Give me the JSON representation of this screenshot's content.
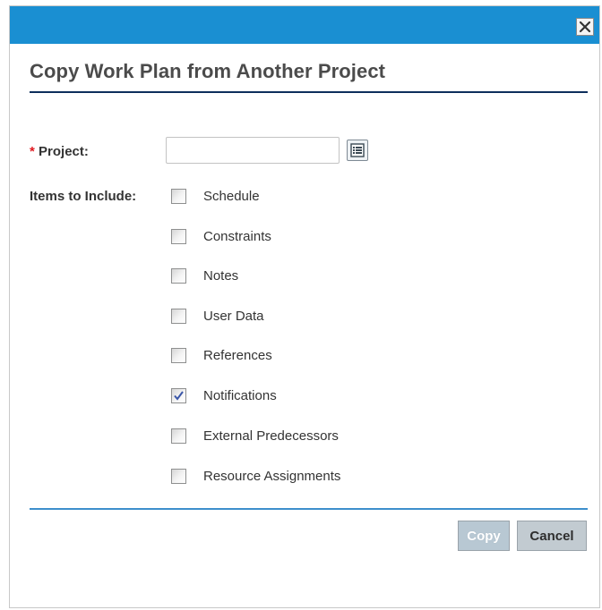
{
  "dialog": {
    "title": "Copy Work Plan from Another Project",
    "close_icon": "close-icon"
  },
  "form": {
    "required_marker": "*",
    "project_label": "Project:",
    "project_value": "",
    "project_placeholder": "",
    "lookup_icon": "list-lookup-icon",
    "items_label": "Items to Include:",
    "items": [
      {
        "label": "Schedule",
        "checked": false
      },
      {
        "label": "Constraints",
        "checked": false
      },
      {
        "label": "Notes",
        "checked": false
      },
      {
        "label": "User Data",
        "checked": false
      },
      {
        "label": "References",
        "checked": false
      },
      {
        "label": "Notifications",
        "checked": true
      },
      {
        "label": "External Predecessors",
        "checked": false
      },
      {
        "label": "Resource Assignments",
        "checked": false
      }
    ]
  },
  "buttons": {
    "copy_label": "Copy",
    "copy_enabled": false,
    "cancel_label": "Cancel"
  },
  "colors": {
    "titlebar": "#1a8fd2",
    "title_rule": "#0d2f5c",
    "bottom_rule": "#3d8fcc",
    "required": "#e0181f"
  }
}
